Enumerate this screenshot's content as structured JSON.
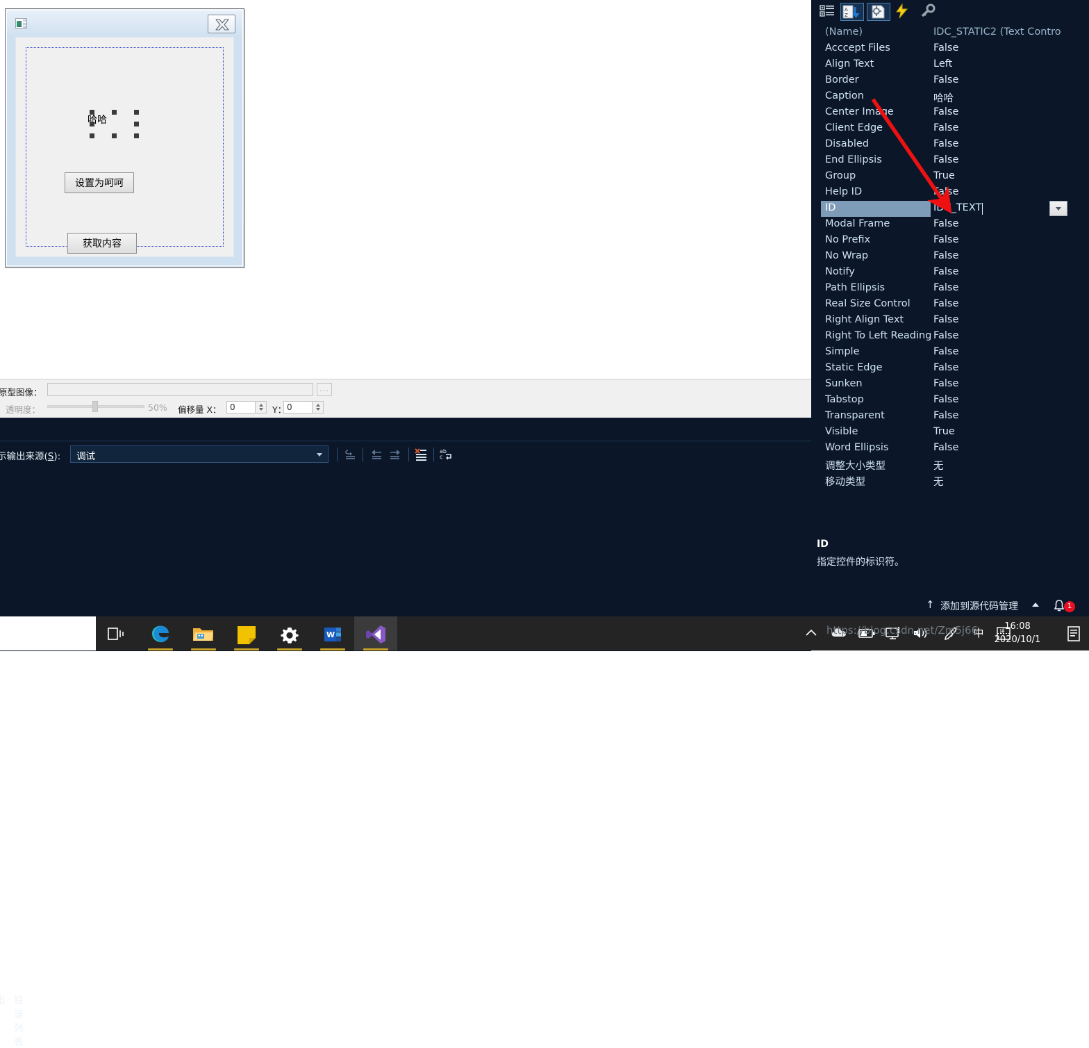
{
  "dialog_editor": {
    "title": "",
    "app_icon": "mfc-app-icon",
    "close_button": "close-icon",
    "static_control": {
      "text": "哈哈",
      "selected": true,
      "handles": 8
    },
    "buttons": [
      {
        "label": "设置为呵呵",
        "name": "set-to-hehe-button"
      },
      {
        "label": "获取内容",
        "name": "get-content-button"
      }
    ]
  },
  "prototype_panel": {
    "image_label": "原型图像：",
    "image_path": "",
    "browse_label": "...",
    "opacity_label": "透明度：",
    "opacity_value": "50%",
    "opacity_percent": 50,
    "offset_label": "偏移量 X：",
    "offset_x": "0",
    "offset_y_label": "Y：",
    "offset_y": "0"
  },
  "output_pane": {
    "source_label_prefix": "示输出来源(",
    "source_label_accel": "S",
    "source_label_suffix": "): ",
    "selected_source": "调试",
    "toolbar_icons": [
      "goto-message-icon",
      "previous-message-icon",
      "next-message-icon",
      "clear-all-icon",
      "toggle-word-wrap-icon"
    ]
  },
  "bottom_tabs": {
    "output_tab": "出",
    "error_list_tab": "错误列表"
  },
  "properties_panel": {
    "toolbar_icons": [
      "categorized-view-icon",
      "alphabetical-sort-icon",
      "property-pages-icon",
      "events-icon",
      "property-manager-icon"
    ],
    "rows": [
      {
        "name": "(Name)",
        "value": "IDC_STATIC2 (Text Contro",
        "header": true
      },
      {
        "name": "Acccept Files",
        "value": "False"
      },
      {
        "name": "Align Text",
        "value": "Left"
      },
      {
        "name": "Border",
        "value": "False"
      },
      {
        "name": "Caption",
        "value": "哈哈"
      },
      {
        "name": "Center Image",
        "value": "False"
      },
      {
        "name": "Client Edge",
        "value": "False"
      },
      {
        "name": "Disabled",
        "value": "False"
      },
      {
        "name": "End Ellipsis",
        "value": "False"
      },
      {
        "name": "Group",
        "value": "True"
      },
      {
        "name": "Help ID",
        "value": "False"
      },
      {
        "name": "ID",
        "value": "IDC_TEXT",
        "selected": true,
        "editing": true
      },
      {
        "name": "Modal Frame",
        "value": "False"
      },
      {
        "name": "No Prefix",
        "value": "False"
      },
      {
        "name": "No Wrap",
        "value": "False"
      },
      {
        "name": "Notify",
        "value": "False"
      },
      {
        "name": "Path Ellipsis",
        "value": "False"
      },
      {
        "name": "Real Size Control",
        "value": "False"
      },
      {
        "name": "Right Align Text",
        "value": "False"
      },
      {
        "name": "Right To Left Reading",
        "value": "False"
      },
      {
        "name": "Simple",
        "value": "False"
      },
      {
        "name": "Static Edge",
        "value": "False"
      },
      {
        "name": "Sunken",
        "value": "False"
      },
      {
        "name": "Tabstop",
        "value": "False"
      },
      {
        "name": "Transparent",
        "value": "False"
      },
      {
        "name": "Visible",
        "value": "True"
      },
      {
        "name": "Word Ellipsis",
        "value": "False"
      },
      {
        "name": "调整大小类型",
        "value": "无"
      },
      {
        "name": "移动类型",
        "value": "无"
      }
    ],
    "description": {
      "title": "ID",
      "text": "指定控件的标识符。"
    }
  },
  "status_bar": {
    "source_control_text": "添加到源代码管理",
    "up_arrow": "↑",
    "caret": "▲",
    "notification_count": "1"
  },
  "taskbar": {
    "items": [
      {
        "name": "task-view-icon",
        "label": "Task View",
        "active": false
      },
      {
        "name": "edge-icon",
        "label": "Microsoft Edge",
        "active": false
      },
      {
        "name": "file-explorer-icon",
        "label": "File Explorer",
        "active": false
      },
      {
        "name": "sticky-notes-icon",
        "label": "Sticky Notes",
        "active": false
      },
      {
        "name": "settings-icon",
        "label": "Settings",
        "active": false
      },
      {
        "name": "word-icon",
        "label": "Microsoft Word",
        "active": false
      },
      {
        "name": "visual-studio-icon",
        "label": "Visual Studio",
        "active": true
      }
    ],
    "tray_icons": [
      "show-hidden-icons-chevron",
      "onedrive-icon",
      "battery-icon",
      "network-icon",
      "volume-icon",
      "pen-icon",
      "ime-chinese-icon",
      "ime-keyboard-icon"
    ],
    "ime_label": "中",
    "clock_time": "16:08",
    "clock_date": "2020/10/1",
    "action_center": "action-center-icon"
  },
  "watermark": "https://blog.csdn.net/Zm5j66",
  "colors": {
    "panel_bg": "#0b1728",
    "selection_blue": "#7e9cb8",
    "accent_red": "#ee1111",
    "dialog_blue": "#cfe0f0"
  }
}
